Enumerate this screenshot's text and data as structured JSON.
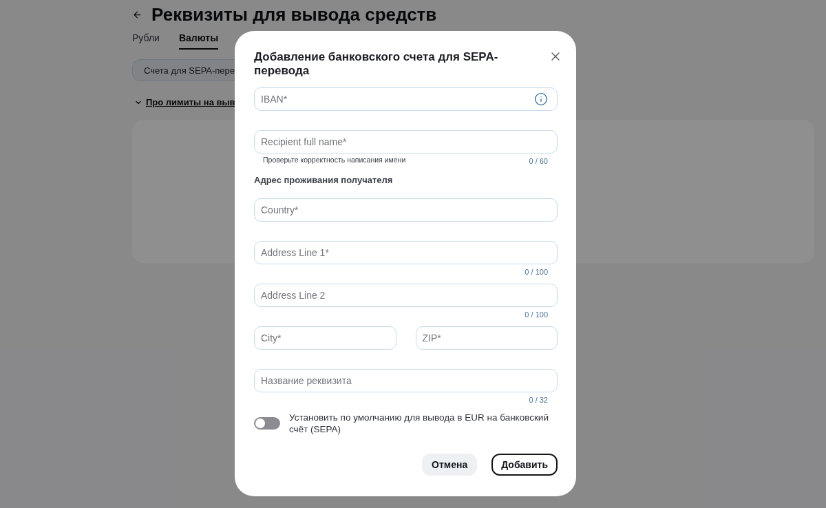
{
  "page": {
    "title": "Реквизиты для вывода средств",
    "tabs": [
      {
        "label": "Рубли",
        "selected": false
      },
      {
        "label": "Валюты",
        "selected": true
      }
    ],
    "account_chip": "Счета для SEPA-пере",
    "limits_link": "Про лимиты на выв"
  },
  "dialog": {
    "title": "Добавление банковского счета для SEPA-перевода",
    "form": [
      {
        "kind": "field",
        "placeholder": "IBAN*",
        "info_button": true
      },
      {
        "kind": "field",
        "placeholder": "Recipient full name*",
        "hint": "Проверьте корректность написания имени",
        "counter": "0 / 60"
      },
      {
        "kind": "heading",
        "label": "Адрес проживания получателя"
      },
      {
        "kind": "field",
        "placeholder": "Country*"
      },
      {
        "kind": "field",
        "placeholder": "Address Line 1*",
        "counter": "0 / 100"
      },
      {
        "kind": "field",
        "placeholder": "Address Line 2",
        "counter": "0 / 100"
      },
      {
        "kind": "pair",
        "fields": [
          {
            "placeholder": "City*"
          },
          {
            "placeholder": "ZIP*"
          }
        ]
      },
      {
        "kind": "field",
        "placeholder": "Название реквизита",
        "counter": "0 / 32"
      }
    ],
    "default_toggle": {
      "label": "Установить по умолчанию для вывода в EUR на банковский счёт (SEPA)",
      "on": false
    },
    "buttons": [
      {
        "label": "Отмена",
        "kind": "secondary"
      },
      {
        "label": "Добавить",
        "kind": "outline"
      }
    ]
  }
}
